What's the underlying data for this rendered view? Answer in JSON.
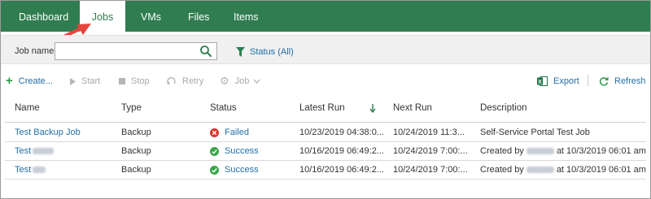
{
  "nav": {
    "tabs": [
      {
        "label": "Dashboard",
        "active": false
      },
      {
        "label": "Jobs",
        "active": true
      },
      {
        "label": "VMs",
        "active": false
      },
      {
        "label": "Files",
        "active": false
      },
      {
        "label": "Items",
        "active": false
      }
    ]
  },
  "filter": {
    "job_name_label": "Job name:",
    "job_name_value": "",
    "status_filter_label": "Status (All)"
  },
  "toolbar": {
    "create": "Create...",
    "start": "Start",
    "stop": "Stop",
    "retry": "Retry",
    "job": "Job",
    "export": "Export",
    "refresh": "Refresh"
  },
  "table": {
    "columns": [
      "Name",
      "Type",
      "Status",
      "Latest Run",
      "Next Run",
      "Description"
    ],
    "sort_column": "Latest Run",
    "sort_direction": "descending",
    "rows": [
      {
        "name": "Test Backup Job",
        "type": "Backup",
        "status": "Failed",
        "latest_run": "10/23/2019 04:38:0...",
        "next_run": "10/24/2019 11:3...",
        "description": "Self-Service Portal Test Job"
      },
      {
        "name": "Test",
        "type": "Backup",
        "status": "Success",
        "latest_run": "10/16/2019 06:49:2...",
        "next_run": "10/24/2019 7:00:...",
        "description_prefix": "Created by",
        "description_suffix": "at 10/3/2019 06:01 am"
      },
      {
        "name": "Test",
        "type": "Backup",
        "status": "Success",
        "latest_run": "10/16/2019 06:49:2...",
        "next_run": "10/24/2019 7:00:...",
        "description_prefix": "Created by",
        "description_suffix": "at 10/3/2019 06:01 am"
      }
    ]
  },
  "colors": {
    "nav_green": "#2f7d50",
    "link_blue": "#1f6ea8",
    "failed_red": "#d9352c",
    "success_green": "#3aa54a",
    "annotation_arrow": "#e8453c"
  }
}
